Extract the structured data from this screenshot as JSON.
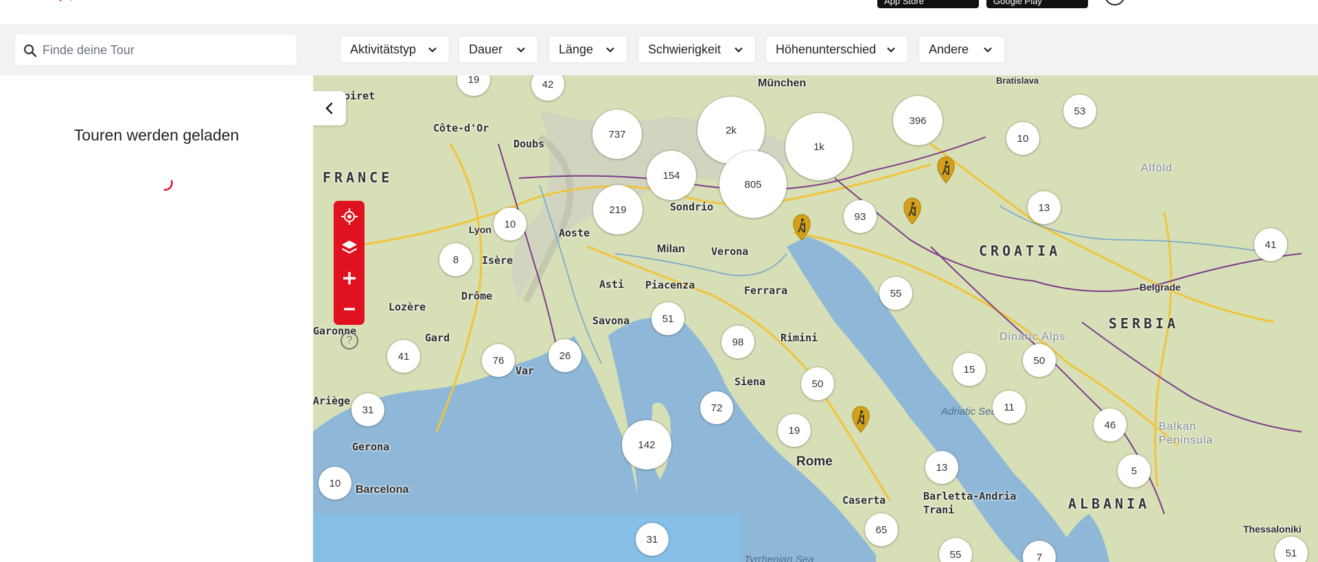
{
  "header": {
    "appstore_label": "App Store",
    "googleplay_label": "Google Play"
  },
  "search": {
    "placeholder": "Finde deine Tour"
  },
  "filters": [
    {
      "label": "Aktivitätstyp"
    },
    {
      "label": "Dauer"
    },
    {
      "label": "Länge"
    },
    {
      "label": "Schwierigkeit"
    },
    {
      "label": "Höhenunterschied"
    },
    {
      "label": "Andere"
    }
  ],
  "panel": {
    "loading_text": "Touren werden geladen"
  },
  "map": {
    "controls": [
      "locate",
      "layers",
      "zoom-in",
      "zoom-out"
    ],
    "help_label": "?",
    "places": [
      {
        "name": "München",
        "kind": "city"
      },
      {
        "name": "Bratislava",
        "kind": "city"
      },
      {
        "name": "Côte-d'Or",
        "kind": "region"
      },
      {
        "name": "Doubs",
        "kind": "region"
      },
      {
        "name": "Loiret",
        "kind": "region"
      },
      {
        "name": "FRANCE",
        "kind": "country"
      },
      {
        "name": "Lyon",
        "kind": "city"
      },
      {
        "name": "Aoste",
        "kind": "region"
      },
      {
        "name": "Sondrio",
        "kind": "region"
      },
      {
        "name": "Milan",
        "kind": "city"
      },
      {
        "name": "Verona",
        "kind": "region"
      },
      {
        "name": "Isère",
        "kind": "region"
      },
      {
        "name": "Drôme",
        "kind": "region"
      },
      {
        "name": "Lozère",
        "kind": "region"
      },
      {
        "name": "Asti",
        "kind": "region"
      },
      {
        "name": "Piacenza",
        "kind": "region"
      },
      {
        "name": "Ferrara",
        "kind": "region"
      },
      {
        "name": "Savona",
        "kind": "region"
      },
      {
        "name": "Garonne",
        "kind": "region"
      },
      {
        "name": "Gard",
        "kind": "region"
      },
      {
        "name": "Var",
        "kind": "region"
      },
      {
        "name": "Rimini",
        "kind": "region"
      },
      {
        "name": "Siena",
        "kind": "region"
      },
      {
        "name": "Ariège",
        "kind": "region"
      },
      {
        "name": "Gerona",
        "kind": "region"
      },
      {
        "name": "Barcelona",
        "kind": "city"
      },
      {
        "name": "Rome",
        "kind": "city"
      },
      {
        "name": "Caserta",
        "kind": "region"
      },
      {
        "name": "Barletta-Andria Trani",
        "kind": "region"
      },
      {
        "name": "CROATIA",
        "kind": "country"
      },
      {
        "name": "SERBIA",
        "kind": "country"
      },
      {
        "name": "ALBANIA",
        "kind": "country"
      },
      {
        "name": "Belgrade",
        "kind": "city"
      },
      {
        "name": "Thessaloniki",
        "kind": "city"
      },
      {
        "name": "Alföld",
        "kind": "region"
      },
      {
        "name": "Dinaric Alps",
        "kind": "region"
      },
      {
        "name": "Balkan Peninsula",
        "kind": "region"
      },
      {
        "name": "Adriatic Sea",
        "kind": "sea"
      },
      {
        "name": "Tyrrhenian Sea",
        "kind": "sea"
      }
    ],
    "clusters": [
      "19",
      "42",
      "737",
      "2k",
      "1k",
      "396",
      "53",
      "10",
      "154",
      "805",
      "219",
      "10",
      "93",
      "13",
      "41",
      "8",
      "55",
      "51",
      "98",
      "41",
      "76",
      "26",
      "15",
      "50",
      "50",
      "72",
      "19",
      "11",
      "46",
      "31",
      "142",
      "13",
      "5",
      "10",
      "31",
      "65",
      "55",
      "7",
      "51"
    ],
    "poi_icon": "hiker-icon",
    "colors": {
      "accent": "#e0121f",
      "sea": "#8fb8d8",
      "land": "#d7e0b8",
      "poi": "#d4a017"
    }
  }
}
